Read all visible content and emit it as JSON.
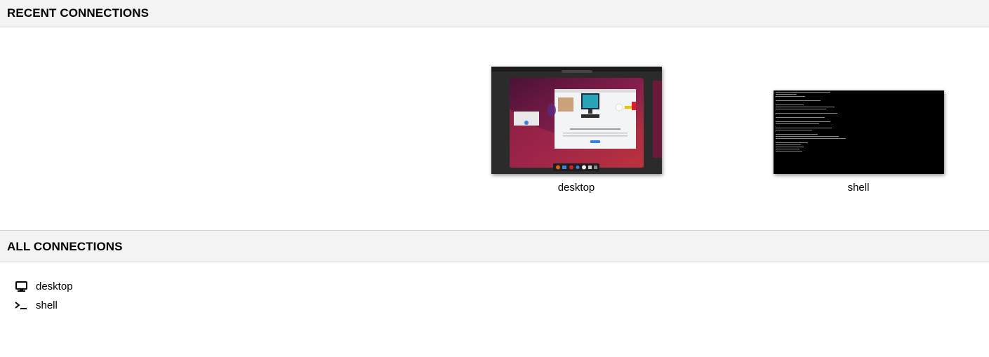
{
  "recent": {
    "title": "RECENT CONNECTIONS",
    "items": [
      {
        "name": "desktop",
        "type": "desktop"
      },
      {
        "name": "shell",
        "type": "terminal"
      }
    ]
  },
  "all": {
    "title": "ALL CONNECTIONS",
    "items": [
      {
        "name": "desktop",
        "icon": "monitor-icon"
      },
      {
        "name": "shell",
        "icon": "terminal-prompt-icon"
      }
    ]
  },
  "colors": {
    "header_bg": "#f3f3f3",
    "border": "#d4d4d4"
  }
}
